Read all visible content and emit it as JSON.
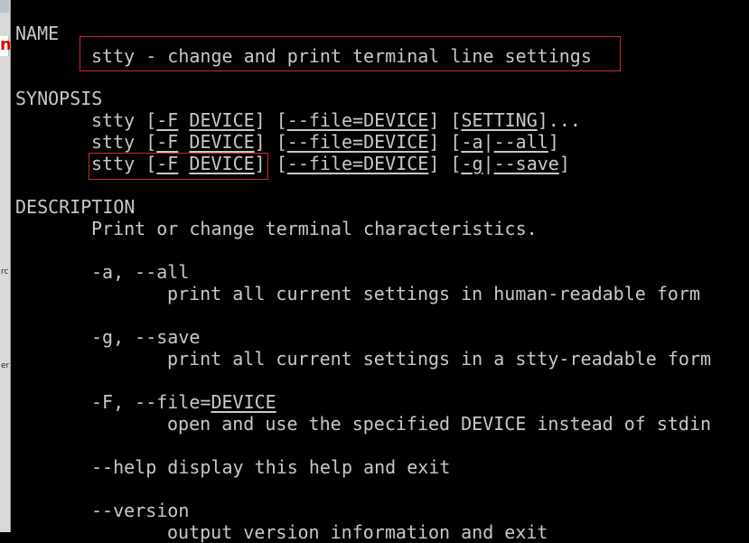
{
  "page": {
    "name_heading": "NAME",
    "name_desc": "stty - change and print terminal line settings",
    "synopsis_heading": "SYNOPSIS",
    "synopsis": [
      {
        "cmd": "stty",
        "b1": "[",
        "f": "-F",
        "sp": " ",
        "device": "DEVICE",
        "b2": "] [",
        "file": "--file=DEVICE",
        "b3": "] [",
        "opt": "SETTING",
        "b4": "]..."
      },
      {
        "cmd": "stty",
        "b1": "[",
        "f": "-F",
        "sp": " ",
        "device": "DEVICE",
        "b2": "] [",
        "file": "--file=DEVICE",
        "b3": "] [",
        "opt1": "-a",
        "pipe": "|",
        "opt2": "--all",
        "b4": "]"
      },
      {
        "cmd": "stty",
        "b1": "[",
        "f": "-F",
        "sp": " ",
        "device": "DEVICE",
        "b2": "] [",
        "file": "--file=DEVICE",
        "b3": "] [",
        "opt1": "-g",
        "pipe": "|",
        "opt2": "--save",
        "b4": "]"
      }
    ],
    "description_heading": "DESCRIPTION",
    "description_intro": "Print or change terminal characteristics.",
    "options": [
      {
        "flag": "-a, --all",
        "text": "print all current settings in human-readable form"
      },
      {
        "flag": "-g, --save",
        "text": "print all current settings in a stty-readable form"
      },
      {
        "flag_prefix": "-F, --file=",
        "flag_device": "DEVICE",
        "text": "open and use the specified DEVICE instead of stdin"
      },
      {
        "flag": "--help",
        "text": "display this help and exit"
      },
      {
        "flag": "--version",
        "text": "output version information and exit"
      }
    ]
  },
  "left_edge": {
    "frag1": "n",
    "frag2": "rc",
    "frag3": "er"
  },
  "colors": {
    "background": "#000000",
    "text": "#c8c8c8",
    "highlight_box": "#d42a2a"
  }
}
